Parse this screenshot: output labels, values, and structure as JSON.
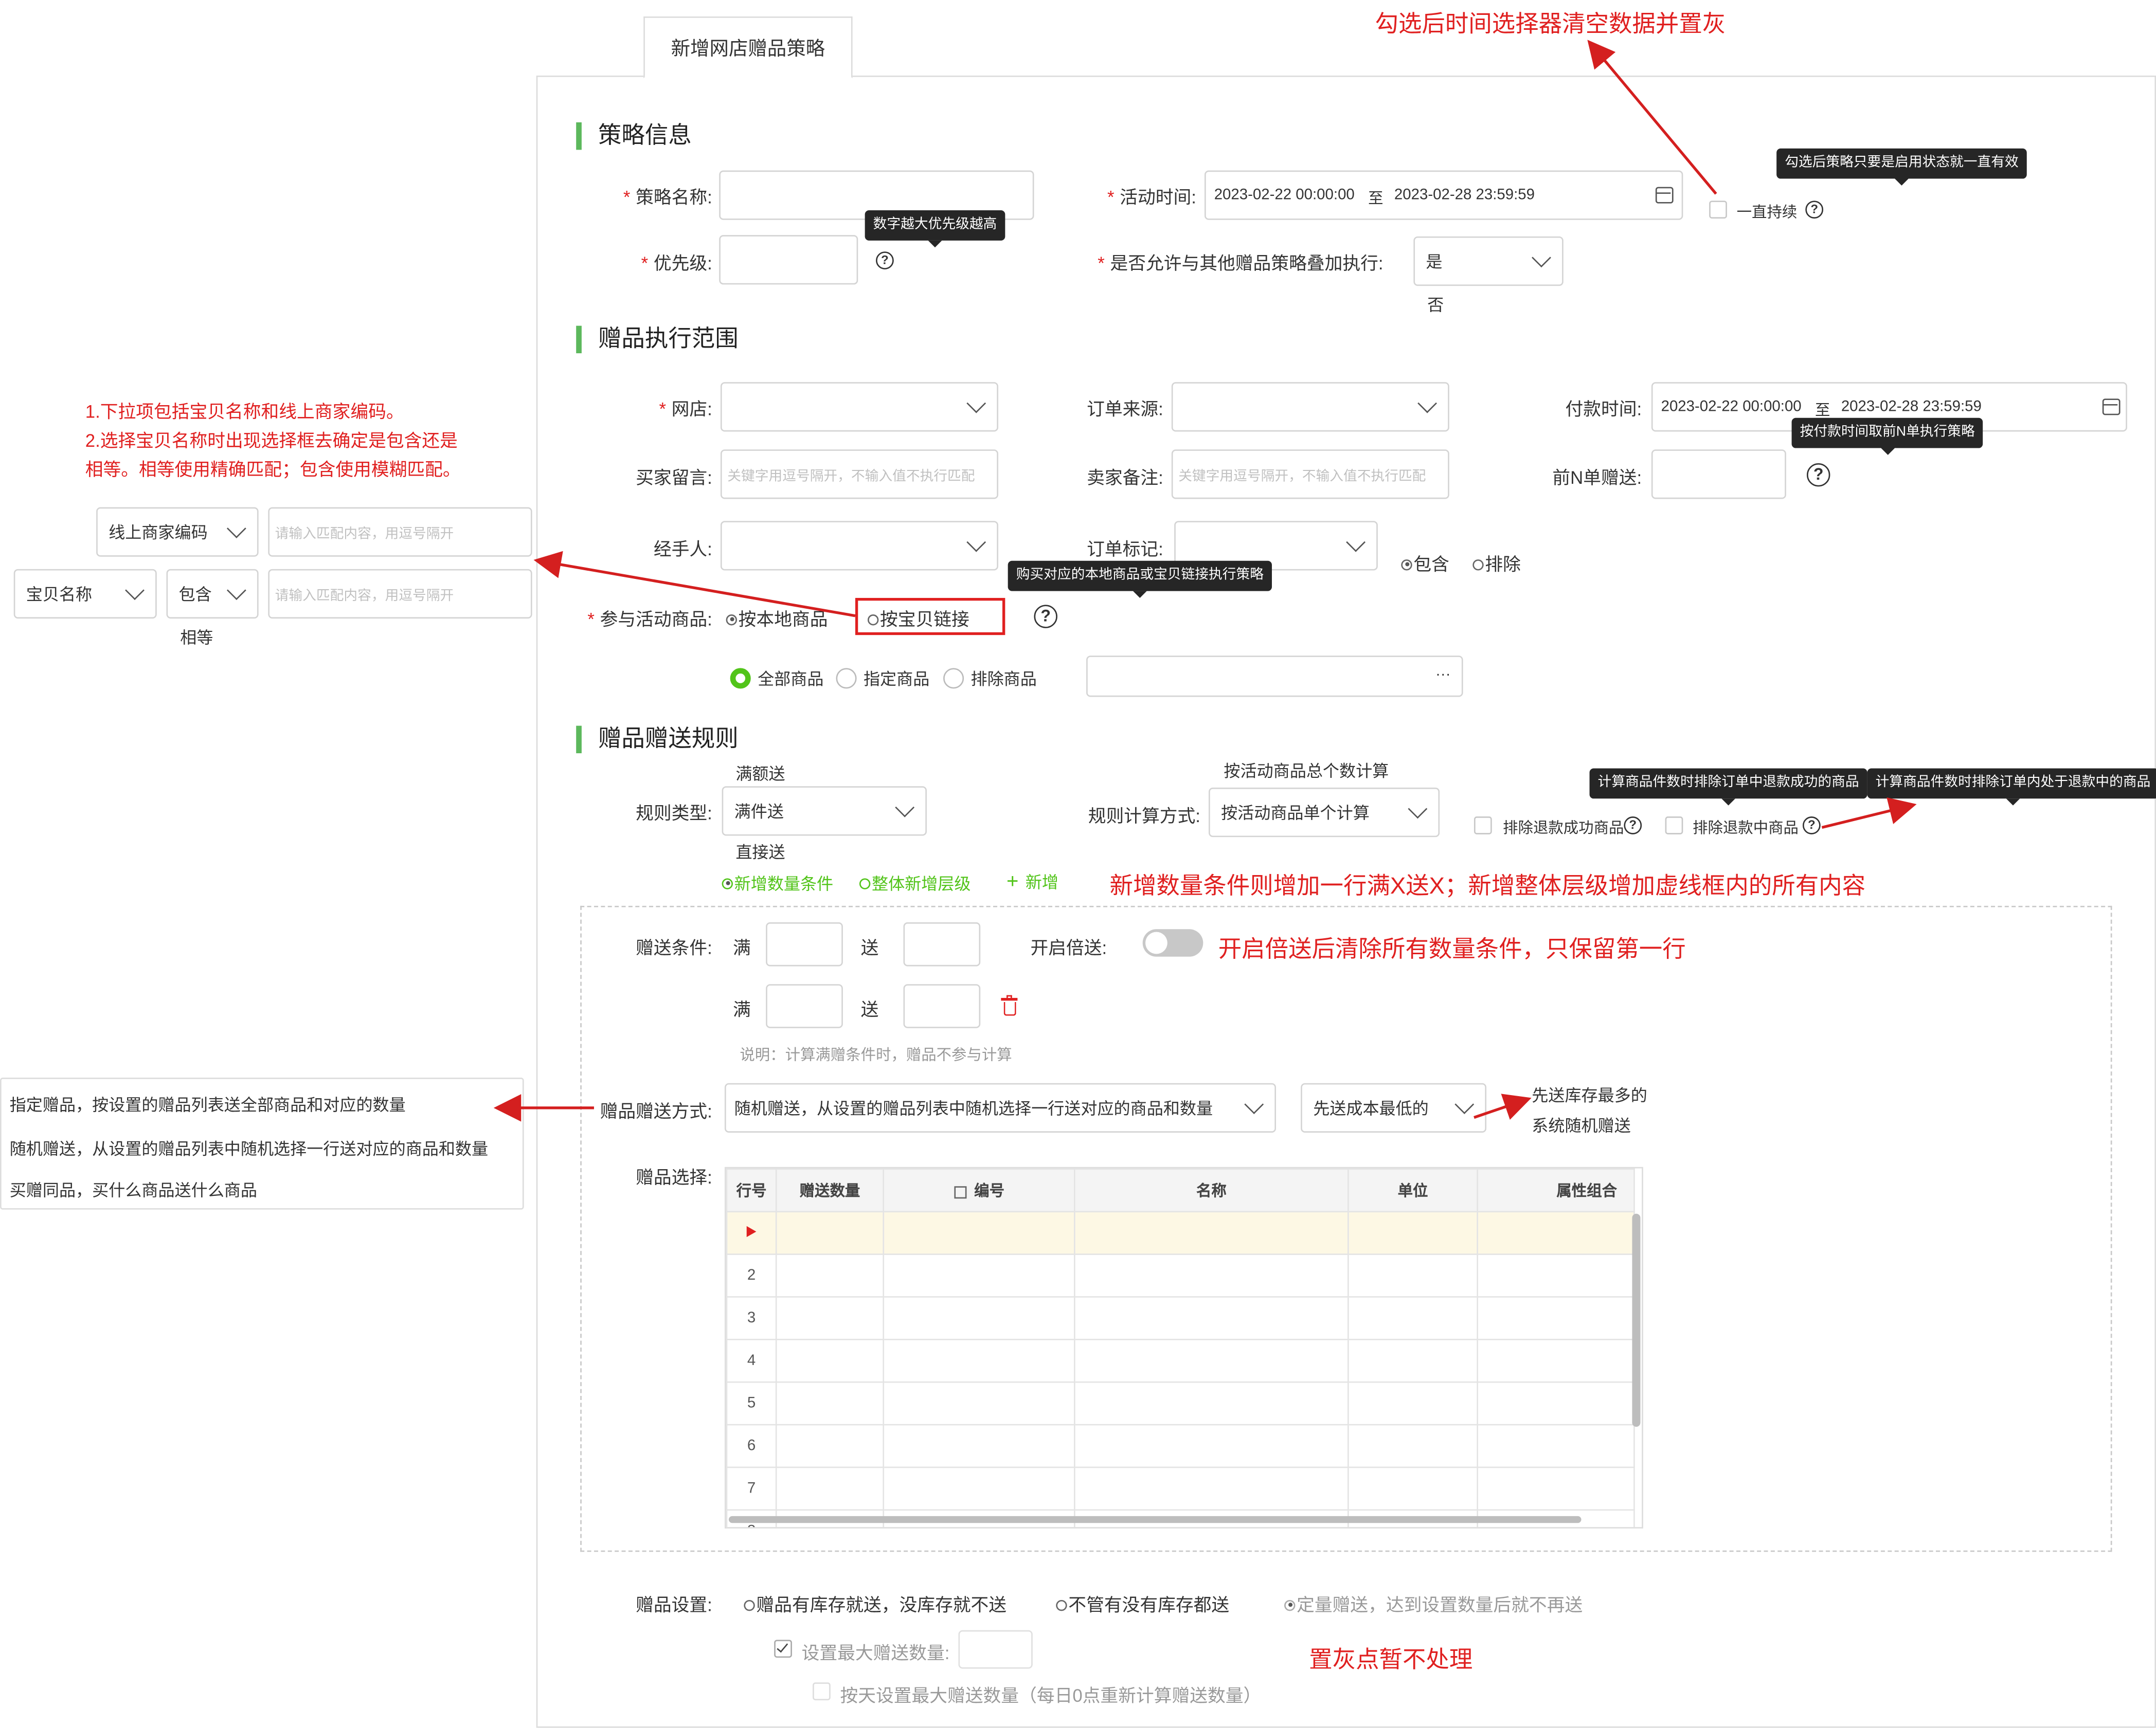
{
  "tab": "新增网店赠品策略",
  "sections": {
    "info": "策略信息",
    "scope": "赠品执行范围",
    "rules": "赠品赠送规则"
  },
  "info": {
    "name_label": "策略名称:",
    "priority_label": "优先级:",
    "priority_tip": "数字越大优先级越高",
    "time_label": "活动时间:",
    "time_start": "2023-02-22 00:00:00",
    "time_to": "至",
    "time_end": "2023-02-28 23:59:59",
    "always_label": "一直持续",
    "always_tip": "勾选后策略只要是启用状态就一直有效",
    "stack_label": "是否允许与其他赠品策略叠加执行:",
    "stack_value": "是",
    "stack_option": "否"
  },
  "scope": {
    "shop_label": "网店:",
    "source_label": "订单来源:",
    "pay_label": "付款时间:",
    "pay_start": "2023-02-22 00:00:00",
    "pay_to": "至",
    "pay_end": "2023-02-28 23:59:59",
    "buyer_label": "买家留言:",
    "buyer_ph": "关键字用逗号隔开，不输入值不执行匹配",
    "seller_label": "卖家备注:",
    "seller_ph": "关键字用逗号隔开，不输入值不执行匹配",
    "firstn_label": "前N单赠送:",
    "firstn_tip": "按付款时间取前N单执行策略",
    "handler_label": "经手人:",
    "mark_label": "订单标记:",
    "include": "包含",
    "exclude": "排除",
    "goods_label": "参与活动商品:",
    "by_local": "按本地商品",
    "by_link": "按宝贝链接",
    "goods_tip": "购买对应的本地商品或宝贝链接执行策略",
    "all_goods": "全部商品",
    "specified_goods": "指定商品",
    "excluded_goods": "排除商品",
    "ellipsis": "···"
  },
  "rules": {
    "type_label": "规则类型:",
    "type_value": "满件送",
    "type_above": "满额送",
    "type_below": "直接送",
    "calc_label": "规则计算方式:",
    "calc_value": "按活动商品单个计算",
    "calc_above": "按活动商品总个数计算",
    "excl_refunded": "排除退款成功商品",
    "excl_refunded_tip": "计算商品件数时排除订单中退款成功的商品",
    "excl_refunding": "排除退款中商品",
    "excl_refunding_tip": "计算商品件数时排除订单内处于退款中的商品",
    "add_qty": "新增数量条件",
    "add_level": "整体新增层级",
    "add": "新增",
    "cond_label": "赠送条件:",
    "full": "满",
    "give": "送",
    "double_label": "开启倍送:",
    "note": "说明：计算满赠条件时，赠品不参与计算",
    "method_label": "赠品赠送方式:",
    "method_value": "随机赠送，从设置的赠品列表中随机选择一行送对应的商品和数量",
    "low_cost": "先送成本最低的",
    "select_label": "赠品选择:",
    "grid_headers": [
      "行号",
      "赠送数量",
      "编号",
      "名称",
      "单位",
      "属性组合"
    ],
    "grid_rows": [
      "",
      "2",
      "3",
      "4",
      "5",
      "6",
      "7",
      "8"
    ],
    "settings_label": "赠品设置:",
    "opt1": "赠品有库存就送，没库存就不送",
    "opt2": "不管有没有库存都送",
    "opt3": "定量赠送，达到设置数量后就不再送",
    "max_label": "设置最大赠送数量:",
    "daily_label": "按天设置最大赠送数量（每日0点重新计算赠送数量）"
  },
  "left_panel": {
    "merchant_code": "线上商家编码",
    "item_name": "宝贝名称",
    "contains": "包含",
    "equals": "相等",
    "ph": "请输入匹配内容，用逗号隔开",
    "method_options": [
      "指定赠品，按设置的赠品列表送全部商品和对应的数量",
      "随机赠送，从设置的赠品列表中随机选择一行送对应的商品和数量",
      "买赠同品，买什么商品送什么商品"
    ]
  },
  "annotations": {
    "time_note": "勾选后时间选择器清空数据并置灰",
    "left_note": [
      "1.下拉项包括宝贝名称和线上商家编码。",
      "2.选择宝贝名称时出现选择框去确定是包含还是",
      "相等。相等使用精确匹配；包含使用模糊匹配。"
    ],
    "add_note": "新增数量条件则增加一行满X送X；新增整体层级增加虚线框内的所有内容",
    "double_note": "开启倍送后清除所有数量条件，只保留第一行",
    "stock_note": [
      "先送库存最多的",
      "系统随机赠送"
    ],
    "grey_note": "置灰点暂不处理"
  },
  "colors": {
    "accent_green": "#52c41a",
    "annotation_red": "#e02020",
    "section_bar": "#5cb85c"
  }
}
